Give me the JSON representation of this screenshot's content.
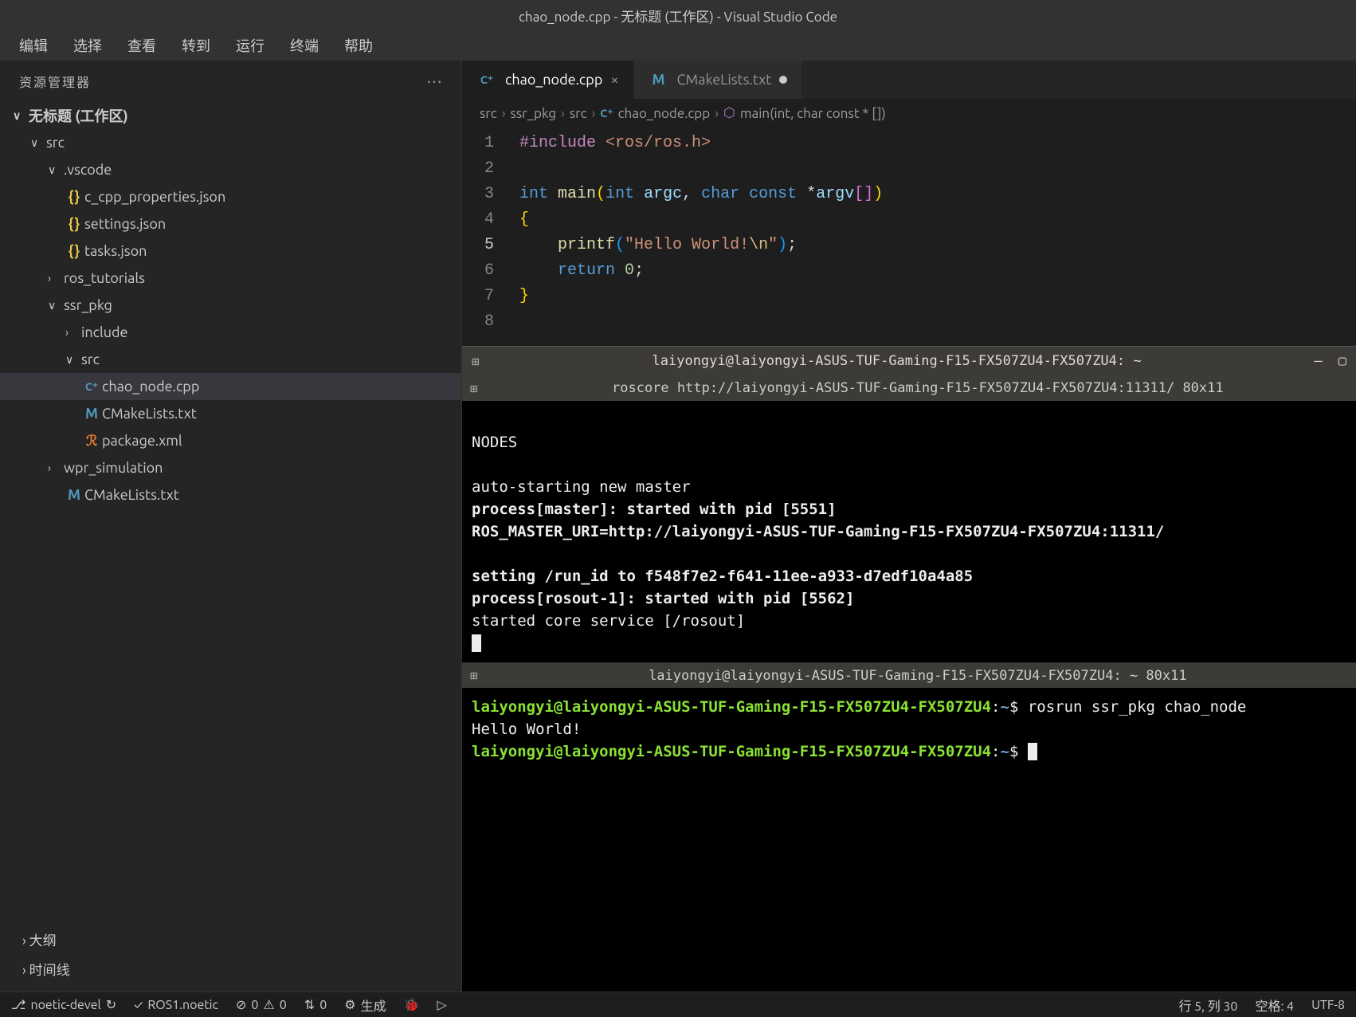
{
  "titleBar": "chao_node.cpp - 无标题 (工作区) - Visual Studio Code",
  "menu": [
    "编辑",
    "选择",
    "查看",
    "转到",
    "运行",
    "终端",
    "帮助"
  ],
  "explorer": {
    "title": "资源管理器",
    "workspace": "无标题 (工作区)",
    "tree": [
      {
        "label": "src",
        "indent": 1,
        "chevron": "∨"
      },
      {
        "label": ".vscode",
        "indent": 2,
        "chevron": "∨"
      },
      {
        "label": "c_cpp_properties.json",
        "indent": 2,
        "icon": "braces"
      },
      {
        "label": "settings.json",
        "indent": 2,
        "icon": "braces"
      },
      {
        "label": "tasks.json",
        "indent": 2,
        "icon": "braces"
      },
      {
        "label": "ros_tutorials",
        "indent": 2,
        "chevron": ">"
      },
      {
        "label": "ssr_pkg",
        "indent": 2,
        "chevron": "∨"
      },
      {
        "label": "include",
        "indent": 3,
        "chevron": ">"
      },
      {
        "label": "src",
        "indent": 3,
        "chevron": "∨"
      },
      {
        "label": "chao_node.cpp",
        "indent": 3,
        "icon": "cpp",
        "active": true
      },
      {
        "label": "CMakeLists.txt",
        "indent": 3,
        "icon": "m"
      },
      {
        "label": "package.xml",
        "indent": 3,
        "icon": "xml"
      },
      {
        "label": "wpr_simulation",
        "indent": 2,
        "chevron": ">"
      },
      {
        "label": "CMakeLists.txt",
        "indent": 2,
        "icon": "m"
      }
    ],
    "footer": [
      "大纲",
      "时间线"
    ]
  },
  "tabs": [
    {
      "label": "chao_node.cpp",
      "icon": "cpp",
      "active": true,
      "closeable": true
    },
    {
      "label": "CMakeLists.txt",
      "icon": "m",
      "dirty": true
    }
  ],
  "breadcrumb": {
    "parts": [
      "src",
      "ssr_pkg",
      "src",
      "chao_node.cpp",
      "main(int, char const * [])"
    ],
    "fileIcon": "cpp",
    "symbolIcon": "cube"
  },
  "code": {
    "lines": [
      1,
      2,
      3,
      4,
      5,
      6,
      7,
      8
    ],
    "currentLine": 5
  },
  "terminal": {
    "windowTitle": "laiyongyi@laiyongyi-ASUS-TUF-Gaming-F15-FX507ZU4-FX507ZU4: ~",
    "tab1Title": "roscore http://laiyongyi-ASUS-TUF-Gaming-F15-FX507ZU4-FX507ZU4:11311/ 80x11",
    "pane1": {
      "nodes": "NODES",
      "line1": "auto-starting new master",
      "line2": "process[master]: started with pid [5551]",
      "line3": "ROS_MASTER_URI=http://laiyongyi-ASUS-TUF-Gaming-F15-FX507ZU4-FX507ZU4:11311/",
      "line4": "setting /run_id to f548f7e2-f641-11ee-a933-d7edf10a4a85",
      "line5": "process[rosout-1]: started with pid [5562]",
      "line6": "started core service [/rosout]"
    },
    "tab2Title": "laiyongyi@laiyongyi-ASUS-TUF-Gaming-F15-FX507ZU4-FX507ZU4: ~ 80x11",
    "pane2": {
      "promptHost": "laiyongyi@laiyongyi-ASUS-TUF-Gaming-F15-FX507ZU4-FX507ZU4",
      "promptPath": "~",
      "cmd1": "rosrun ssr_pkg chao_node",
      "out1": "Hello World!"
    }
  },
  "statusBar": {
    "branch": "noetic-devel",
    "sync": "↻",
    "ros": "ROS1.noetic",
    "errors": "0",
    "warnings": "0",
    "ports": "0",
    "build": "生成",
    "lineCol": "行 5, 列 30",
    "spaces": "空格: 4",
    "encoding": "UTF-8"
  }
}
